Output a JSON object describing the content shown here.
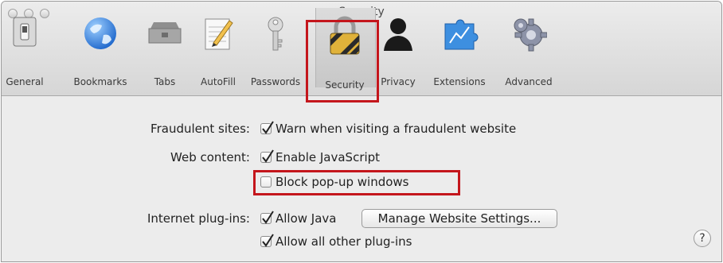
{
  "window": {
    "title": "Security"
  },
  "toolbar": {
    "items": [
      {
        "label": "General",
        "icon": "general-switch-icon"
      },
      {
        "label": "Bookmarks",
        "icon": "globe-icon"
      },
      {
        "label": "Tabs",
        "icon": "tabs-icon"
      },
      {
        "label": "AutoFill",
        "icon": "autofill-pencil-icon"
      },
      {
        "label": "Passwords",
        "icon": "key-icon"
      },
      {
        "label": "Security",
        "icon": "padlock-icon",
        "selected": true
      },
      {
        "label": "Privacy",
        "icon": "person-silhouette-icon"
      },
      {
        "label": "Extensions",
        "icon": "puzzle-piece-icon"
      },
      {
        "label": "Advanced",
        "icon": "gears-icon"
      }
    ]
  },
  "security": {
    "fraudulent_label": "Fraudulent sites:",
    "fraudulent_option": {
      "label": "Warn when visiting a fraudulent website",
      "checked": true
    },
    "web_content_label": "Web content:",
    "javascript_option": {
      "label": "Enable JavaScript",
      "checked": true
    },
    "popups_option": {
      "label": "Block pop-up windows",
      "checked": false
    },
    "plugins_label": "Internet plug-ins:",
    "java_option": {
      "label": "Allow Java",
      "checked": true
    },
    "manage_button": "Manage Website Settings...",
    "other_plugins_option": {
      "label": "Allow all other plug-ins",
      "checked": true
    },
    "help_glyph": "?"
  },
  "colors": {
    "annotation_red": "#c4161c",
    "window_bg": "#ececec"
  }
}
